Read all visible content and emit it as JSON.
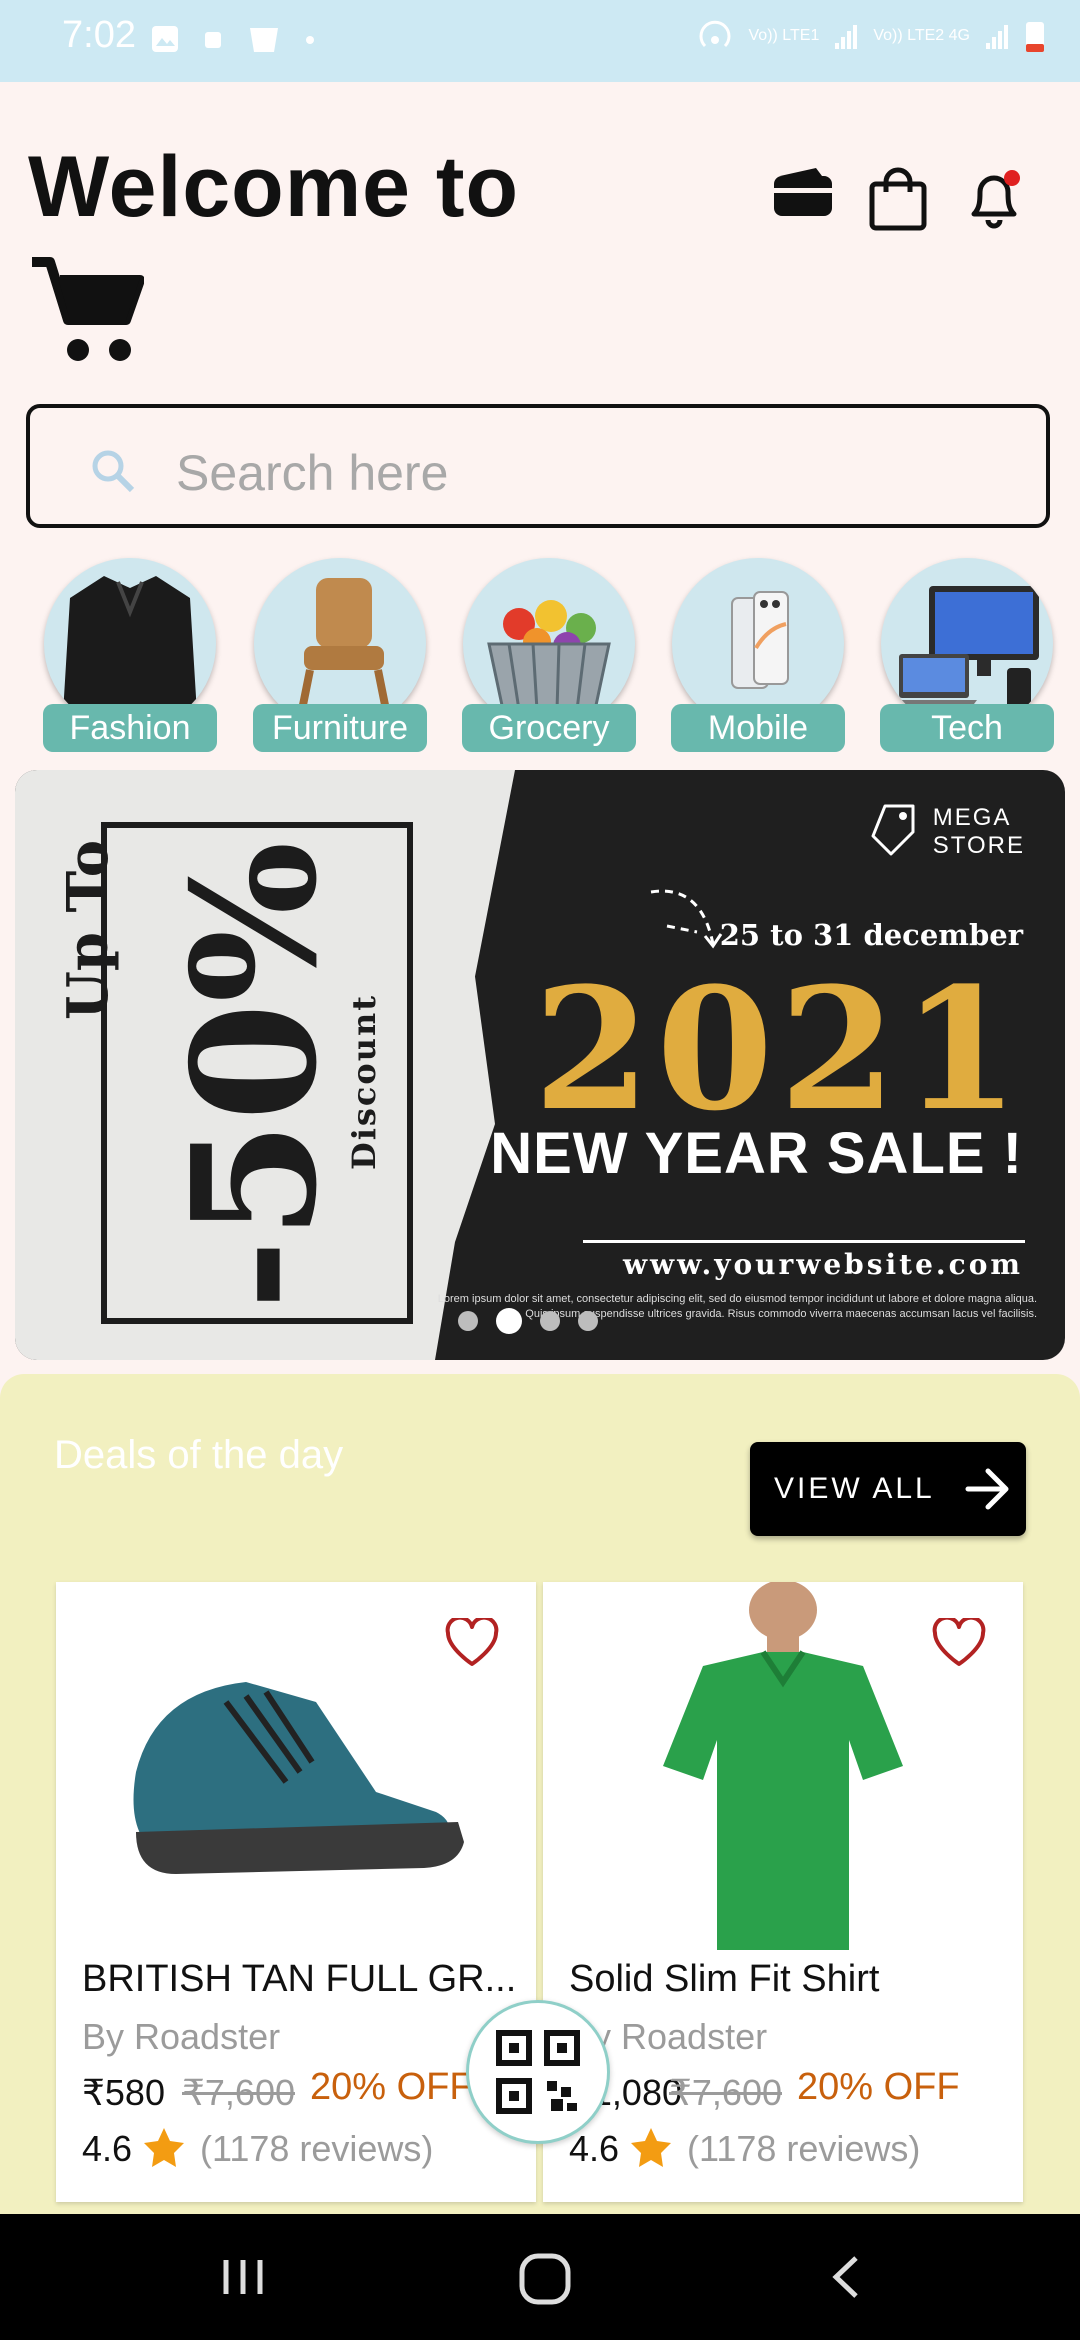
{
  "status_bar": {
    "time": "7:02",
    "sim1": "Vo)) LTE1",
    "sim2": "Vo)) LTE2 4G"
  },
  "header": {
    "welcome": "Welcome to"
  },
  "search": {
    "placeholder": "Search here"
  },
  "categories": [
    {
      "label": "Fashion"
    },
    {
      "label": "Furniture"
    },
    {
      "label": "Grocery"
    },
    {
      "label": "Mobile"
    },
    {
      "label": "Tech"
    }
  ],
  "banner": {
    "up_to": "Up To",
    "discount_value": "-50%",
    "discount_word": "Discount",
    "brand_line1": "MEGA",
    "brand_line2": "STORE",
    "dates": "25 to 31 december",
    "year": "2021",
    "sale": "NEW YEAR SALE !",
    "website": "www.yourwebsite.com",
    "lorem": "Lorem ipsum dolor sit amet, consectetur adipiscing elit, sed do eiusmod tempor incididunt ut labore et dolore magna aliqua. Quis ipsum suspendisse ultrices gravida. Risus commodo viverra maecenas accumsan lacus vel facilisis.",
    "slide_count": 4,
    "active_slide": 2
  },
  "deals": {
    "title": "Deals of the day",
    "view_all": "VIEW ALL",
    "products": [
      {
        "name": "BRITISH TAN FULL GR...",
        "brand": "By Roadster",
        "price": "₹580",
        "old_price": "₹7,600",
        "discount": "20% OFF",
        "rating": "4.6",
        "reviews": "(1178 reviews)"
      },
      {
        "name": "Solid Slim Fit Shirt",
        "brand": "By Roadster",
        "price": "₹1,080",
        "old_price": "₹7,600",
        "discount": "20% OFF",
        "rating": "4.6",
        "reviews": "(1178 reviews)"
      }
    ]
  },
  "colors": {
    "accent": "#68b8ad",
    "deals_bg": "#f2f0c0",
    "discount": "#c8600c",
    "star": "#f39c12",
    "heart": "#b22222",
    "year_gold": "#e0ac3f"
  }
}
